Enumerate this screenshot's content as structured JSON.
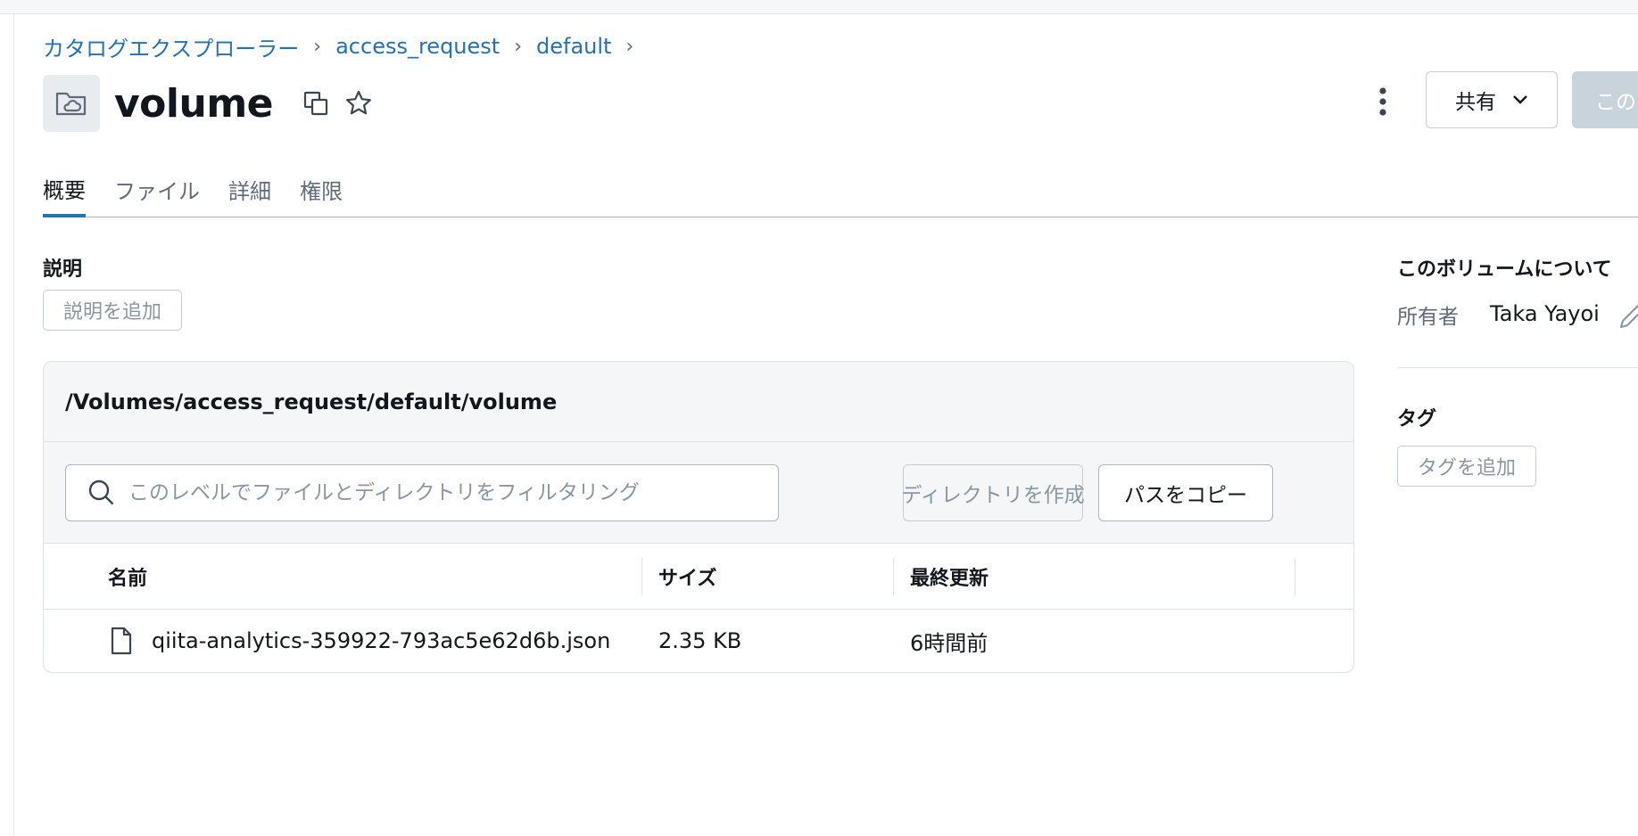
{
  "breadcrumb": {
    "items": [
      "カタログエクスプローラー",
      "access_request",
      "default"
    ],
    "separator": "›"
  },
  "header": {
    "title": "volume",
    "share_label": "共有",
    "primary_label": "この"
  },
  "tabs": [
    {
      "label": "概要",
      "active": true
    },
    {
      "label": "ファイル",
      "active": false
    },
    {
      "label": "詳細",
      "active": false
    },
    {
      "label": "権限",
      "active": false
    }
  ],
  "description": {
    "label": "説明",
    "add_button": "説明を追加"
  },
  "files": {
    "path": "/Volumes/access_request/default/volume",
    "search_placeholder": "このレベルでファイルとディレクトリをフィルタリング",
    "create_dir_label": "ディレクトリを作成",
    "copy_path_label": "パスをコピー",
    "columns": [
      "名前",
      "サイズ",
      "最終更新"
    ],
    "rows": [
      {
        "name": "qiita-analytics-359922-793ac5e62d6b.json",
        "size": "2.35 KB",
        "modified": "6時間前"
      }
    ]
  },
  "about": {
    "title": "このボリュームについて",
    "owner_label": "所有者",
    "owner_value": "Taka Yayoi"
  },
  "tags": {
    "label": "タグ",
    "add_button": "タグを追加"
  },
  "colors": {
    "link": "#2272b4",
    "tab_active_underline": "#2272b4",
    "primary_disabled": "#c9d3dc",
    "card_bg": "#f4f6f8"
  }
}
